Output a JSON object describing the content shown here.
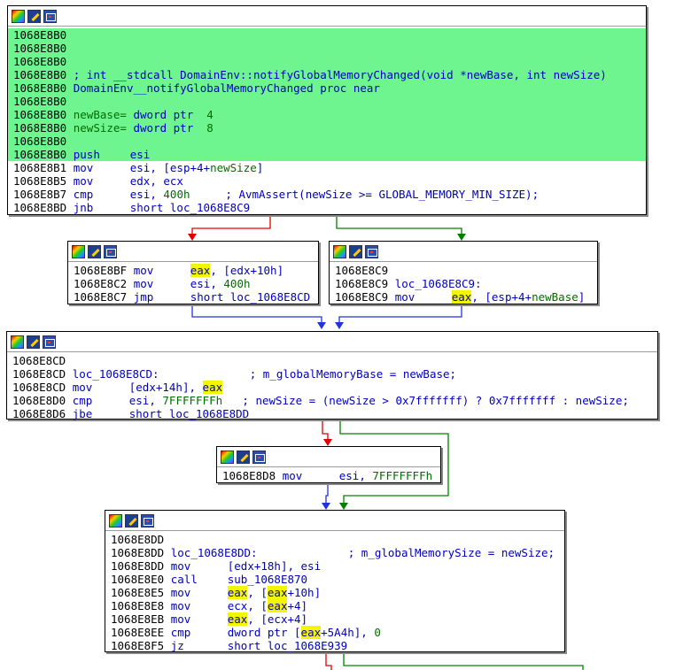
{
  "blocks": {
    "b1": {
      "lines": [
        {
          "a": "1068E8B0",
          "t": ""
        },
        {
          "a": "1068E8B0",
          "t": ""
        },
        {
          "a": "1068E8B0",
          "t": ""
        },
        {
          "a": "1068E8B0",
          "t": "; int __stdcall DomainEnv::notifyGlobalMemoryChanged(void *newBase, int newSize)"
        },
        {
          "a": "1068E8B0",
          "t": "DomainEnv__notifyGlobalMemoryChanged proc near"
        },
        {
          "a": "1068E8B0",
          "t": ""
        },
        {
          "a": "1068E8B0",
          "t1": "newBase=",
          "t2": " dword ptr ",
          "t3": " 4"
        },
        {
          "a": "1068E8B0",
          "t1": "newSize=",
          "t2": " dword ptr ",
          "t3": " 8"
        },
        {
          "a": "1068E8B0",
          "t": ""
        },
        {
          "a": "1068E8B0",
          "m": "push",
          "o": "esi"
        },
        {
          "a": "1068E8B1",
          "m": "mov",
          "o": "esi, [esp+4+",
          "o2": "newSize",
          "o3": "]"
        },
        {
          "a": "1068E8B5",
          "m": "mov",
          "o": "edx, ecx"
        },
        {
          "a": "1068E8B7",
          "m": "cmp",
          "o": "esi, ",
          "n": "400h",
          "c": "; AvmAssert(newSize >= GLOBAL_MEMORY_MIN_SIZE);"
        },
        {
          "a": "1068E8BD",
          "m": "jnb",
          "o": "short loc_1068E8C9"
        }
      ]
    },
    "b2": {
      "lines": [
        {
          "a": "1068E8BF",
          "m": "mov",
          "r": "eax",
          "o": ", [edx+10h]"
        },
        {
          "a": "1068E8C2",
          "m": "mov",
          "o": "esi, ",
          "n": "400h"
        },
        {
          "a": "1068E8C7",
          "m": "jmp",
          "o": "short loc_1068E8CD"
        }
      ]
    },
    "b3": {
      "lines": [
        {
          "a": "1068E8C9",
          "t": ""
        },
        {
          "a": "1068E8C9",
          "t": "loc_1068E8C9:"
        },
        {
          "a": "1068E8C9",
          "m": "mov",
          "r": "eax",
          "o": ", [esp+4+",
          "o2": "newBase",
          "o3": "]"
        }
      ]
    },
    "b4": {
      "lines": [
        {
          "a": "1068E8CD",
          "t": ""
        },
        {
          "a": "1068E8CD",
          "t": "loc_1068E8CD:",
          "c": "; m_globalMemoryBase = newBase;"
        },
        {
          "a": "1068E8CD",
          "m": "mov",
          "o": "[edx+14h], ",
          "r": "eax"
        },
        {
          "a": "1068E8D0",
          "m": "cmp",
          "o": "esi, ",
          "n": "7FFFFFFFh",
          "c": "; newSize = (newSize > 0x7fffffff) ? 0x7fffffff : newSize;"
        },
        {
          "a": "1068E8D6",
          "m": "jbe",
          "o": "short loc_1068E8DD"
        }
      ]
    },
    "b5": {
      "lines": [
        {
          "a": "1068E8D8",
          "m": "mov",
          "o": "esi, ",
          "n": "7FFFFFFFh"
        }
      ]
    },
    "b6": {
      "lines": [
        {
          "a": "1068E8DD",
          "t": ""
        },
        {
          "a": "1068E8DD",
          "t": "loc_1068E8DD:",
          "c": "; m_globalMemorySize = newSize;"
        },
        {
          "a": "1068E8DD",
          "m": "mov",
          "o": "[edx+18h], esi"
        },
        {
          "a": "1068E8E0",
          "m": "call",
          "o": "sub_1068E870"
        },
        {
          "a": "1068E8E5",
          "m": "mov",
          "r": "eax",
          "o": ", [",
          "r2": "eax",
          "o2": "+10h]"
        },
        {
          "a": "1068E8E8",
          "m": "mov",
          "o": "ecx, [",
          "r2": "eax",
          "o2": "+4]"
        },
        {
          "a": "1068E8EB",
          "m": "mov",
          "r": "eax",
          "o": ", [ecx+4]"
        },
        {
          "a": "1068E8EE",
          "m": "cmp",
          "o": "dword ptr [",
          "r2": "eax",
          "o2": "+5A4h], ",
          "n": "0"
        },
        {
          "a": "1068E8F5",
          "m": "jz",
          "o": "short loc_1068E939"
        }
      ]
    }
  },
  "colors": {
    "highlight": "#6ef58f",
    "register_highlight": "#f5f500",
    "edge_false": "#e00000",
    "edge_true": "#008000",
    "edge_uncond": "#2233dd"
  },
  "icons": [
    "color-icon",
    "edit-icon",
    "graph-icon"
  ]
}
